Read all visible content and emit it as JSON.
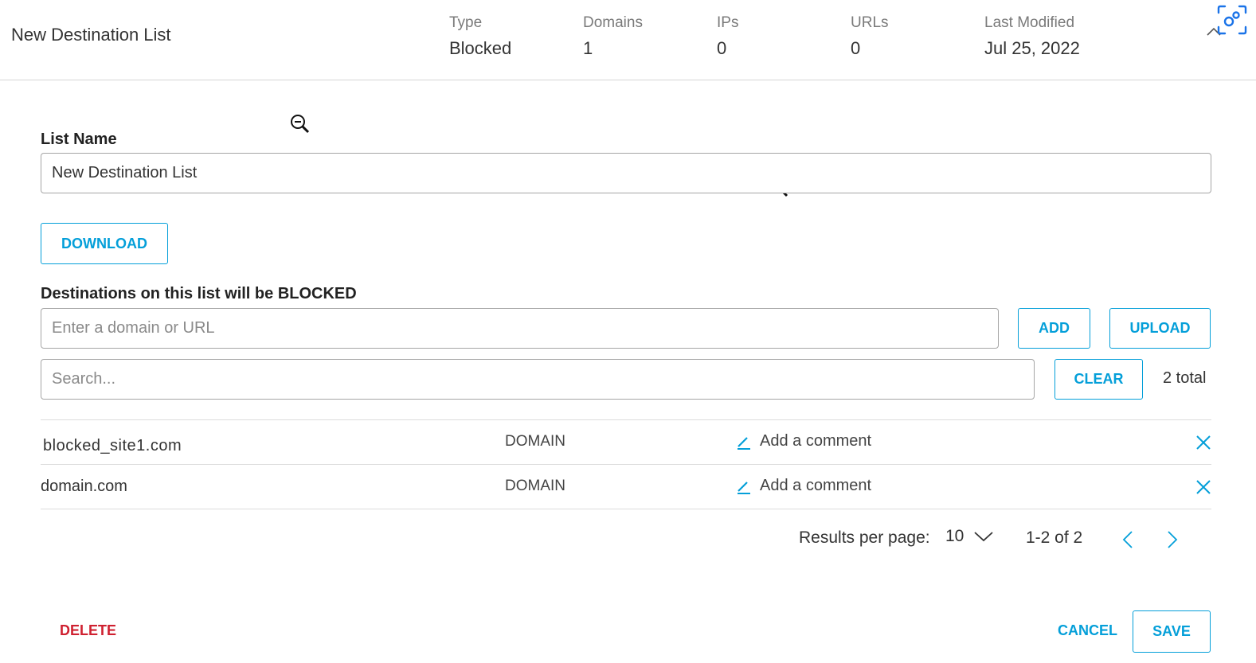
{
  "header": {
    "title": "New Destination List",
    "meta": [
      {
        "label": "Type",
        "value": "Blocked"
      },
      {
        "label": "Domains",
        "value": "1"
      },
      {
        "label": "IPs",
        "value": "0"
      },
      {
        "label": "URLs",
        "value": "0"
      },
      {
        "label": "Last Modified",
        "value": "Jul 25, 2022"
      }
    ]
  },
  "form": {
    "list_name_label": "List Name",
    "list_name_value": "New Destination List",
    "download_label": "DOWNLOAD",
    "destinations_label": "Destinations on this list will be BLOCKED",
    "domain_placeholder": "Enter a domain or URL",
    "add_label": "ADD",
    "upload_label": "UPLOAD",
    "search_placeholder": "Search...",
    "clear_label": "CLEAR",
    "total_text": "2 total"
  },
  "table": {
    "rows": [
      {
        "destination": "blocked_site1.com",
        "type": "DOMAIN",
        "comment": "Add a comment"
      },
      {
        "destination": "domain.com",
        "type": "DOMAIN",
        "comment": "Add a comment"
      }
    ]
  },
  "pagination": {
    "results_label": "Results per page:",
    "per_page": "10",
    "range": "1-2 of 2"
  },
  "footer": {
    "delete_label": "DELETE",
    "cancel_label": "CANCEL",
    "save_label": "SAVE"
  },
  "colors": {
    "accent": "#049fd9",
    "danger": "#cf2030",
    "border": "#a5a5a5"
  },
  "icons": [
    "collapse-icon",
    "screen-capture-icon",
    "zoom-out-cursor-icon",
    "pencil-icon",
    "close-icon",
    "chevron-down-icon",
    "chevron-left-icon",
    "chevron-right-icon"
  ]
}
